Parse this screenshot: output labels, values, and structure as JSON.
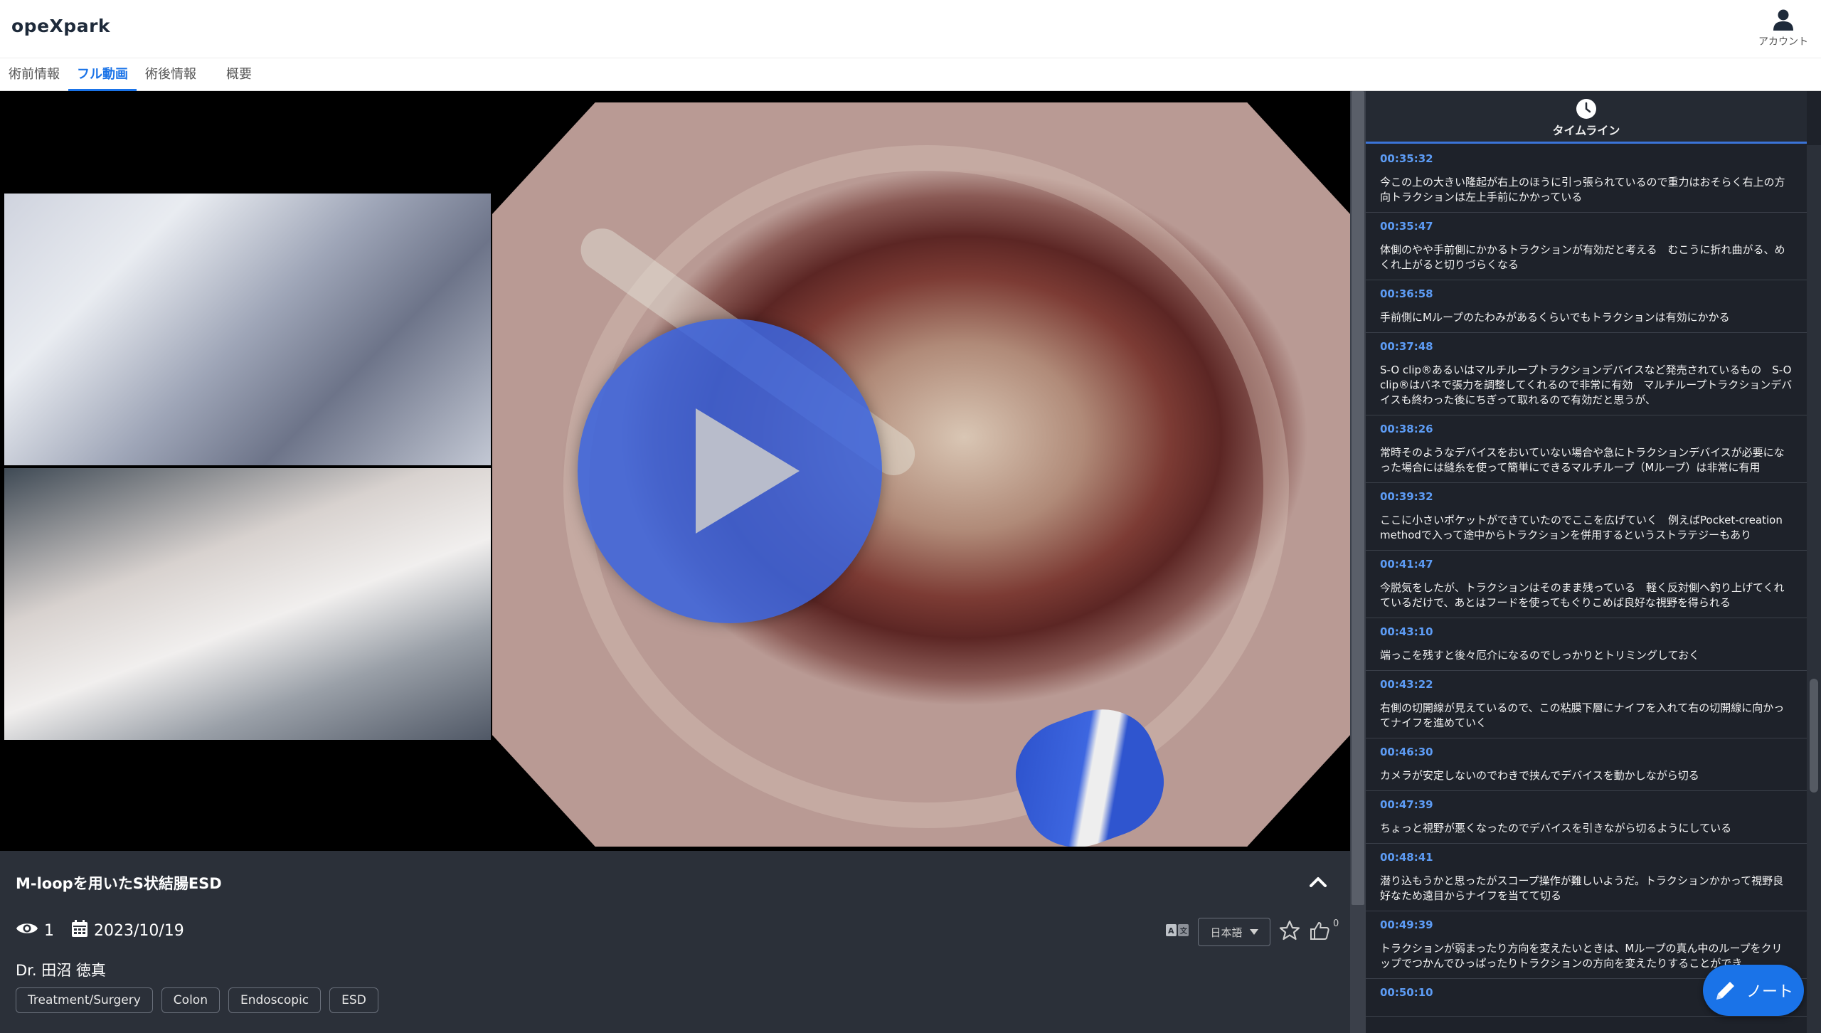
{
  "app": {
    "logo": "opeXpark",
    "account_label": "アカウント"
  },
  "tabs": [
    {
      "label": "術前情報"
    },
    {
      "label": "フル動画",
      "active": true
    },
    {
      "label": "術後情報"
    },
    {
      "label": "概要"
    }
  ],
  "video": {
    "title": "M-loopを用いたS状結腸ESD",
    "views": "1",
    "date": "2023/10/19",
    "doctor": "Dr. 田沼 徳真",
    "tags": [
      "Treatment/Surgery",
      "Colon",
      "Endoscopic",
      "ESD"
    ],
    "language": "日本語",
    "like_count": "0"
  },
  "timeline": {
    "header_label": "タイムライン",
    "entries": [
      {
        "time": "00:35:32",
        "text": "今この上の大きい隆起が右上のほうに引っ張られているので重力はおそらく右上の方向トラクションは左上手前にかかっている"
      },
      {
        "time": "00:35:47",
        "text": "体側のやや手前側にかかるトラクションが有効だと考える　むこうに折れ曲がる、めくれ上がると切りづらくなる"
      },
      {
        "time": "00:36:58",
        "text": "手前側にMループのたわみがあるくらいでもトラクションは有効にかかる"
      },
      {
        "time": "00:37:48",
        "text": "S-O clip®あるいはマルチループトラクションデバイスなど発売されているもの　S-O clip®はバネで張力を調整してくれるので非常に有効　マルチループトラクションデバイスも終わった後にちぎって取れるので有効だと思うが、"
      },
      {
        "time": "00:38:26",
        "text": "常時そのようなデバイスをおいていない場合や急にトラクションデバイスが必要になった場合には縫糸を使って簡単にできるマルチループ（Mループ）は非常に有用"
      },
      {
        "time": "00:39:32",
        "text": "ここに小さいポケットができていたのでここを広げていく　例えばPocket-creation methodで入って途中からトラクションを併用するというストラテジーもあり"
      },
      {
        "time": "00:41:47",
        "text": "今脱気をしたが、トラクションはそのまま残っている　軽く反対側へ釣り上げてくれているだけで、あとはフードを使ってもぐりこめば良好な視野を得られる"
      },
      {
        "time": "00:43:10",
        "text": "端っこを残すと後々厄介になるのでしっかりとトリミングしておく"
      },
      {
        "time": "00:43:22",
        "text": "右側の切開線が見えているので、この粘膜下層にナイフを入れて右の切開線に向かってナイフを進めていく"
      },
      {
        "time": "00:46:30",
        "text": "カメラが安定しないのでわきで挟んでデバイスを動かしながら切る"
      },
      {
        "time": "00:47:39",
        "text": "ちょっと視野が悪くなったのでデバイスを引きながら切るようにしている"
      },
      {
        "time": "00:48:41",
        "text": "潜り込もうかと思ったがスコープ操作が難しいようだ。トラクションかかって視野良好なため遠目からナイフを当てて切る"
      },
      {
        "time": "00:49:39",
        "text": "トラクションが弱まったり方向を変えたいときは、Mループの真ん中のループをクリップでつかんでひっぱったりトラクションの方向を変えたりすることができ"
      },
      {
        "time": "00:50:10",
        "text": ""
      }
    ]
  },
  "note_button": {
    "label": "ノート"
  },
  "colors": {
    "accent": "#1a73e8",
    "timestamp": "#5d9cf5",
    "panel": "#2b3039",
    "timeline_bg": "#1e222a",
    "play_button": "#3c64dc"
  },
  "icons": [
    "user-icon",
    "play-icon",
    "eye-icon",
    "calendar-icon",
    "translate-icon",
    "chevron-down-icon",
    "star-icon",
    "thumbs-up-icon",
    "clock-icon",
    "pencil-icon",
    "chevron-up-icon"
  ]
}
